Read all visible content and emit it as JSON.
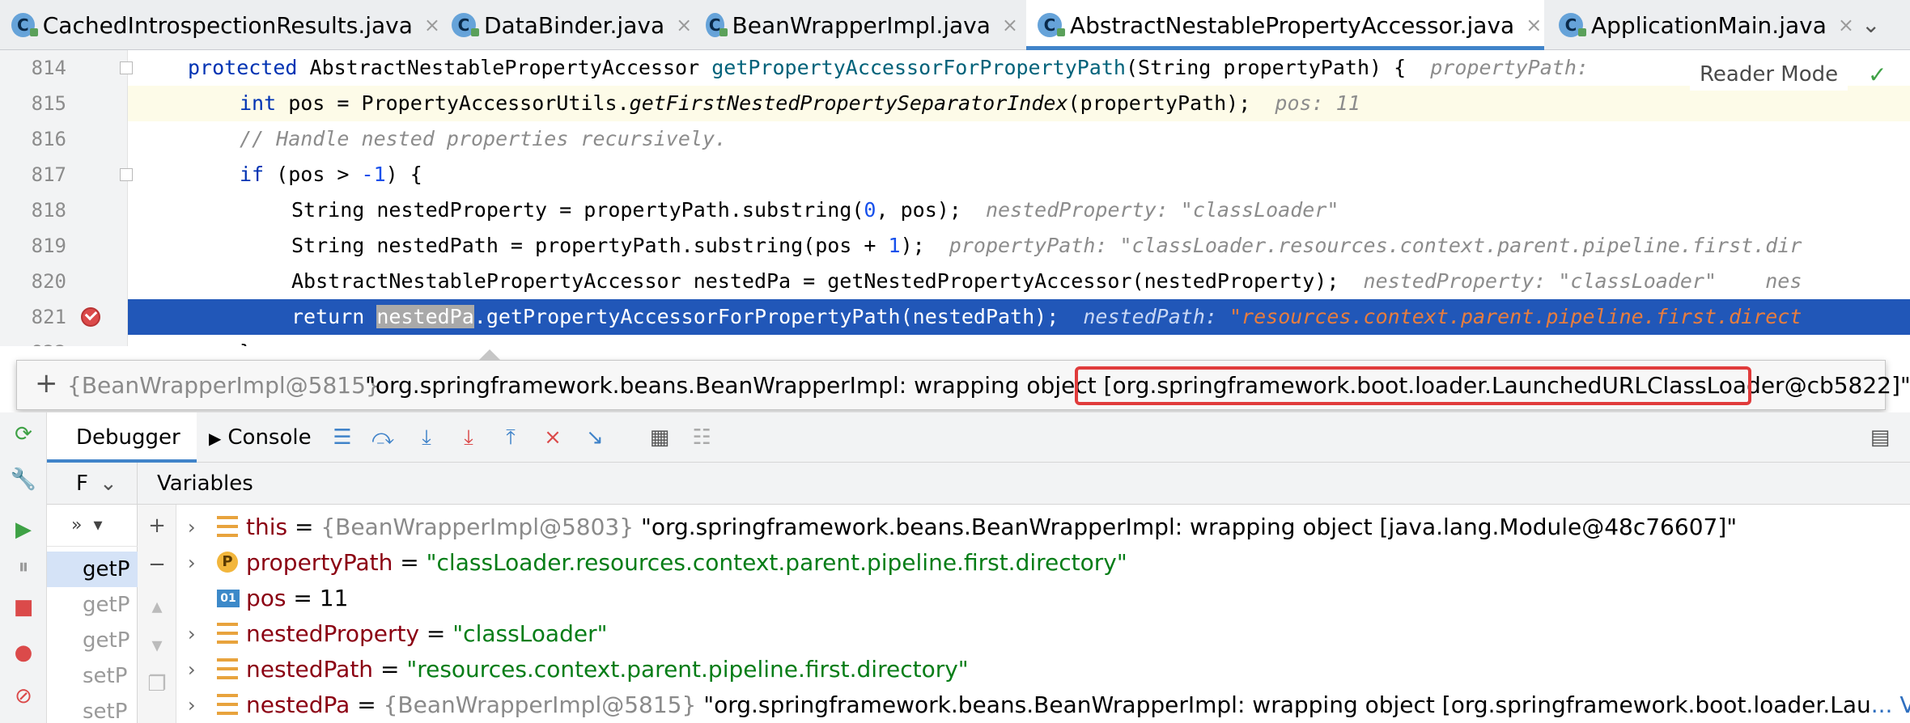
{
  "tabs": [
    {
      "label": "CachedIntrospectionResults.java",
      "active": false
    },
    {
      "label": "DataBinder.java",
      "active": false
    },
    {
      "label": "BeanWrapperImpl.java",
      "active": false
    },
    {
      "label": "AbstractNestablePropertyAccessor.java",
      "active": true
    },
    {
      "label": "ApplicationMain.java",
      "active": false
    }
  ],
  "tab_close_glyph": "×",
  "tab_dropdown_glyph": "⌄",
  "class_icon_letter": "C",
  "editor": {
    "reader_mode": "Reader Mode",
    "lines": [
      {
        "no": "814",
        "code": [
          "protected",
          " AbstractNestablePropertyAccessor ",
          "getPropertyAccessorForPropertyPath",
          "(String propertyPath) {",
          "  propertyPath:"
        ]
      },
      {
        "no": "815",
        "code": [
          "int",
          " pos = PropertyAccessorUtils.",
          "getFirstNestedPropertySeparatorIndex",
          "(propertyPath);",
          "  pos: 11"
        ]
      },
      {
        "no": "816",
        "code": [
          "// Handle nested properties recursively."
        ]
      },
      {
        "no": "817",
        "code": [
          "if",
          " (pos > ",
          "-1",
          ") {"
        ]
      },
      {
        "no": "818",
        "code": [
          "String nestedProperty = propertyPath.substring(",
          "0",
          ", pos);",
          "  nestedProperty: \"classLoader\""
        ]
      },
      {
        "no": "819",
        "code": [
          "String nestedPath = propertyPath.substring(pos + ",
          "1",
          ");",
          "  propertyPath: \"classLoader.resources.context.parent.pipeline.first.dir"
        ]
      },
      {
        "no": "820",
        "code": [
          "AbstractNestablePropertyAccessor nestedPa = getNestedPropertyAccessor(nestedProperty);",
          "  nestedProperty: \"classLoader\"    nes"
        ]
      },
      {
        "no": "821",
        "code": [
          "return",
          " ",
          "nestedPa",
          ".getPropertyAccessorForPropertyPath(nestedPath);",
          "  nestedPath: ",
          "\"resources.context.parent.pipeline.first.direct"
        ]
      },
      {
        "no": "822",
        "code": [
          "}"
        ]
      }
    ]
  },
  "popup": {
    "plus": "+",
    "ref": "{BeanWrapperImpl@5815}",
    "value_prefix": "\"org.springframework.beans.BeanWrapperImpl: wrapping object ",
    "value_highlight": "[org.springframework.boot.loader.LaunchedURLClassLoader",
    "value_suffix": "@cb5822]\""
  },
  "debugger": {
    "tab_debugger": "Debugger",
    "tab_console": "Console",
    "frames_label": "F",
    "variables_label": "Variables",
    "frames_tools": "»",
    "frames": [
      "getP",
      "getP",
      "getP",
      "setP",
      "setP"
    ],
    "variables": [
      {
        "arrow": true,
        "icon": "field",
        "name": "this",
        "ref": "{BeanWrapperImpl@5803}",
        "value": " \"org.springframework.beans.BeanWrapperImpl: wrapping object [java.lang.Module@48c76607]\"",
        "value_kind": "obj"
      },
      {
        "arrow": true,
        "icon": "param",
        "name": "propertyPath",
        "ref": "",
        "value": "\"classLoader.resources.context.parent.pipeline.first.directory\"",
        "value_kind": "str"
      },
      {
        "arrow": false,
        "icon": "prim",
        "name": "pos",
        "ref": "",
        "value": "11",
        "value_kind": "obj"
      },
      {
        "arrow": true,
        "icon": "field",
        "name": "nestedProperty",
        "ref": "",
        "value": "\"classLoader\"",
        "value_kind": "str"
      },
      {
        "arrow": true,
        "icon": "field",
        "name": "nestedPath",
        "ref": "",
        "value": "\"resources.context.parent.pipeline.first.directory\"",
        "value_kind": "str"
      },
      {
        "arrow": true,
        "icon": "field",
        "name": "nestedPa",
        "ref": "{BeanWrapperImpl@5815}",
        "value": " \"org.springframework.beans.BeanWrapperImpl: wrapping object [org.springframework.boot.loader.Lau",
        "value_kind": "obj"
      }
    ],
    "param_icon_letter": "P",
    "prim_icon_text": "01",
    "more_link": "... View"
  },
  "colors": {
    "accent": "#4083c9",
    "selection": "#2157b8",
    "highlight_box": "#e03b3b"
  }
}
